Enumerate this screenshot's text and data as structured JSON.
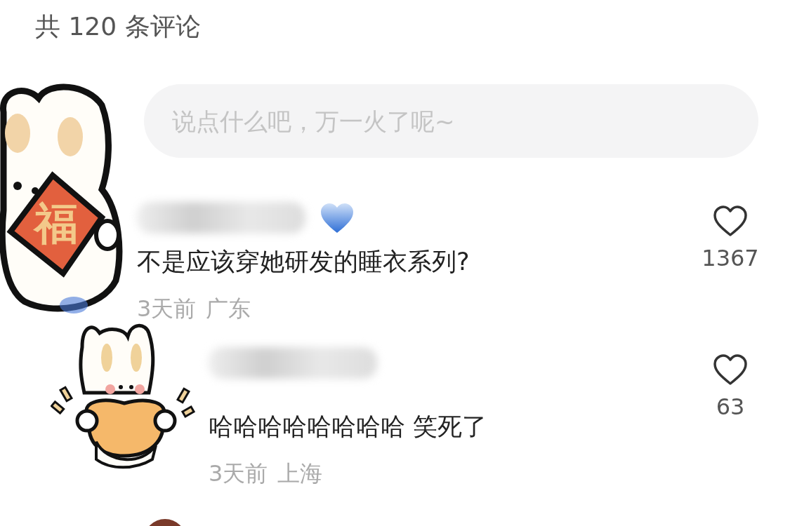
{
  "header": {
    "title": "共 120 条评论"
  },
  "comment_box": {
    "placeholder": "说点什么吧，万一火了呢~"
  },
  "comments": [
    {
      "kind": "comment",
      "badge": true,
      "text": "不是应该穿她研发的睡衣系列?",
      "time": "3天前",
      "location": "广东",
      "likes": "1367"
    },
    {
      "kind": "reply",
      "badge": false,
      "text": "哈哈哈哈哈哈哈哈 笑死了",
      "time": "3天前",
      "location": "上海",
      "likes": "63"
    }
  ],
  "stickers": [
    {
      "kind": "fu",
      "text": "福"
    },
    {
      "kind": "ingot"
    }
  ]
}
